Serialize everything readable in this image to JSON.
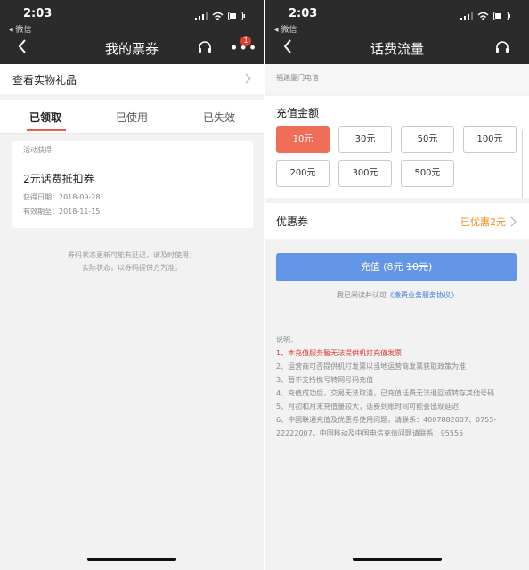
{
  "status_bar": {
    "time": "2:03",
    "back_app": "◂ 微信"
  },
  "left": {
    "title": "我的票券",
    "badge_count": "1",
    "gift_row": "查看实物礼品",
    "tabs": [
      "已领取",
      "已使用",
      "已失效"
    ],
    "active_tab": "已领取",
    "card": {
      "source": "活动获得",
      "title": "2元话费抵扣券",
      "obtained": "获得日期：2018-09-28",
      "valid_until": "有效期至：2018-11-15"
    },
    "notice_line1": "券码状态更新可能有延迟，请及时使用；",
    "notice_line2": "实际状态，以券码提供方为准。"
  },
  "right": {
    "title": "话费流量",
    "carrier": "福建厦门电信",
    "amount_title": "充值金额",
    "amounts": [
      "10元",
      "30元",
      "50元",
      "100元",
      "200元",
      "300元",
      "500元"
    ],
    "selected_amount": "10元",
    "coupon_label": "优惠券",
    "coupon_value": "已优惠2元",
    "button_price": "充值 (8元 ",
    "button_original": "10元",
    "button_close": ")",
    "agree_prefix": "我已阅读并认可",
    "agree_link": "《缴费业务服务协议》",
    "notes_title": "说明：",
    "notes": [
      "1、本充值服务暂无法提供机打充值发票",
      "2、运营商可否提供机打发票以当地运营商发票获取政策为准",
      "3、暂不支持携号转网号码充值",
      "4、充值成功后，交易无法取消，已充值话费无法退回或转存其他号码",
      "5、月初和月末充值量较大，话费到账时间可能会出现延迟",
      "6、中国联通充值及优惠券使用问题，请联系：4007882007、0755-22222007，中国移动及中国电信充值问题请联系：95555"
    ]
  },
  "colors": {
    "accent_red": "#f06e58",
    "button_blue": "#6295e6",
    "coupon_orange": "#f08a24",
    "link_blue": "#3b78d8"
  }
}
